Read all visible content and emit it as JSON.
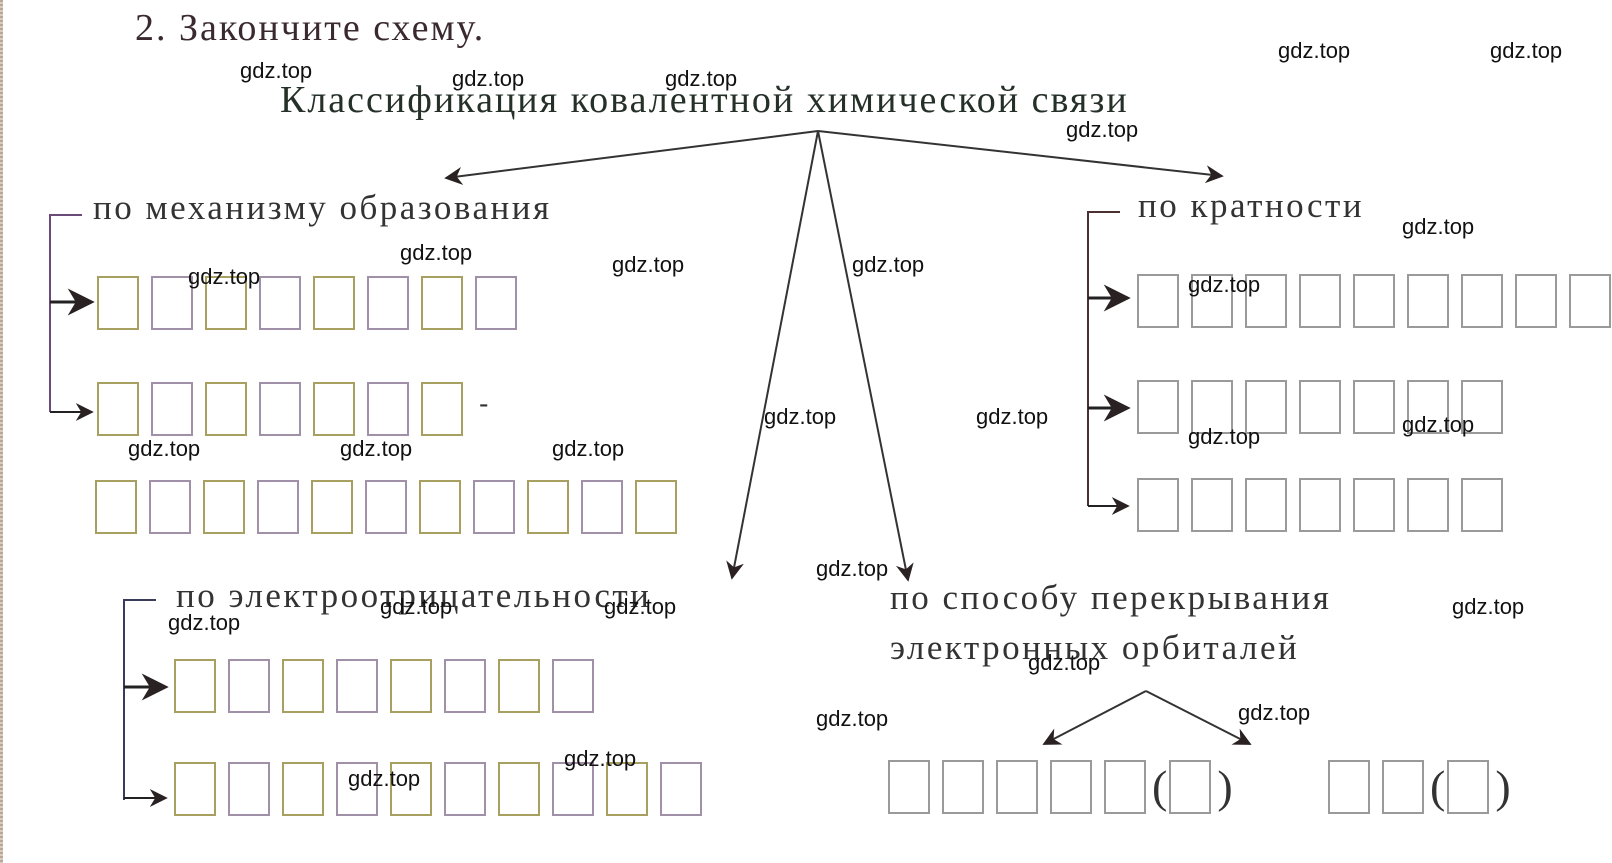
{
  "task": {
    "number": "2.",
    "instruction": "Закончите схему."
  },
  "heading": "Классификация ковалентной химической связи",
  "branches": {
    "mechanism": {
      "label": "по механизму образования",
      "rows": [
        {
          "boxes": 8,
          "suffix": ""
        },
        {
          "boxes": 7,
          "suffix": "-"
        },
        {
          "boxes": 11,
          "suffix": ""
        }
      ]
    },
    "multiplicity": {
      "label": "по кратности",
      "rows": [
        {
          "boxes": 9
        },
        {
          "boxes": 7
        },
        {
          "boxes": 7
        }
      ]
    },
    "electronegativity": {
      "label": "по электроотрицательности",
      "rows": [
        {
          "boxes": 8
        },
        {
          "boxes": 10
        }
      ]
    },
    "overlap": {
      "label_line1": "по способу перекрывания",
      "label_line2": "электронных орбиталей",
      "groups": [
        {
          "boxes": 5,
          "paren_boxes": 1,
          "open": "(",
          "close": ")"
        },
        {
          "boxes": 2,
          "paren_boxes": 1,
          "open": "(",
          "close": ")"
        }
      ]
    }
  },
  "watermark": "gdz.top"
}
